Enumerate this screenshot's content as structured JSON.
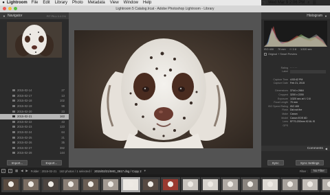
{
  "menubar": {
    "app": "Lightroom",
    "items": [
      "File",
      "Edit",
      "Library",
      "Photo",
      "Metadata",
      "View",
      "Window",
      "Help"
    ],
    "clock": "Wed Mar 9  2:06 PM"
  },
  "window": {
    "title": "Lightroom 5 Catalog.lrcat - Adobe Photoshop Lightroom - Library"
  },
  "left": {
    "navigator_label": "Navigator",
    "navigator_modes": "FIT  FILL  1:1  2:1",
    "folders": [
      {
        "name": "2015-02-14",
        "count": "27"
      },
      {
        "name": "2015-02-17",
        "count": "13"
      },
      {
        "name": "2015-02-18",
        "count": "102"
      },
      {
        "name": "2015-02-19",
        "count": "99"
      },
      {
        "name": "2015-02-20",
        "count": "23"
      },
      {
        "name": "2015-02-21",
        "count": "163"
      },
      {
        "name": "2015-02-22",
        "count": "43"
      },
      {
        "name": "2015-02-23",
        "count": "123"
      },
      {
        "name": "2015-02-24",
        "count": "64"
      },
      {
        "name": "2015-02-25",
        "count": "21"
      },
      {
        "name": "2015-02-26",
        "count": "35"
      },
      {
        "name": "2015-02-27",
        "count": "382"
      },
      {
        "name": "2015-02-28",
        "count": "144"
      }
    ],
    "selected_folder_index": 5,
    "import_label": "Import...",
    "export_label": "Export..."
  },
  "right": {
    "histogram_label": "Histogram",
    "histo_info": [
      "ISO 400",
      "70 mm",
      "f / 2.8",
      "1/320 sec"
    ],
    "preview_label": "Original + Smart Preview",
    "metadata": [
      {
        "k": "Rating",
        "v": "· · · · ·",
        "box": false
      },
      {
        "k": "Label",
        "v": "",
        "box": true
      },
      {
        "k": "",
        "v": "",
        "box": false
      },
      {
        "k": "Capture Time",
        "v": "4:53:42 PM",
        "box": false
      },
      {
        "k": "Capture Date",
        "v": "Feb 21, 2015",
        "box": false
      },
      {
        "k": "",
        "v": "",
        "box": false
      },
      {
        "k": "Dimensions",
        "v": "3744 x 2664",
        "box": false
      },
      {
        "k": "Cropped",
        "v": "3200 x 2200",
        "box": false
      },
      {
        "k": "Exposure",
        "v": "1/320 sec at f / 2.8",
        "box": false
      },
      {
        "k": "Focal Length",
        "v": "70 mm",
        "box": false
      },
      {
        "k": "ISO Speed Rating",
        "v": "ISO 400",
        "box": false
      },
      {
        "k": "Flash",
        "v": "Did not fire",
        "box": false
      },
      {
        "k": "Make",
        "v": "Canon",
        "box": false
      },
      {
        "k": "Model",
        "v": "Canon EOS 6D",
        "box": false
      },
      {
        "k": "Lens",
        "v": "EF70-200mm f/2.8L IS",
        "box": false
      },
      {
        "k": "GPS",
        "v": "",
        "box": false
      }
    ],
    "comments_label": "Comments",
    "sync_label": "Sync",
    "sync_settings_label": "Sync Settings"
  },
  "stripbar": {
    "page1": "1",
    "page2": "2",
    "folder_text": "Folder : 2015-02-21",
    "count_text": "163 photos / 1 selected /",
    "path": "2015/02/21/IMG_0917.dng / Copy 2",
    "filter_label": "Filter :",
    "filter_value": "No Filter"
  },
  "colors": {
    "accent_selected": "#b7b7b7",
    "panel": "#2b2b2b",
    "canvas": "#535353"
  },
  "filmstrip": {
    "count": 17,
    "selected_index": 6
  }
}
